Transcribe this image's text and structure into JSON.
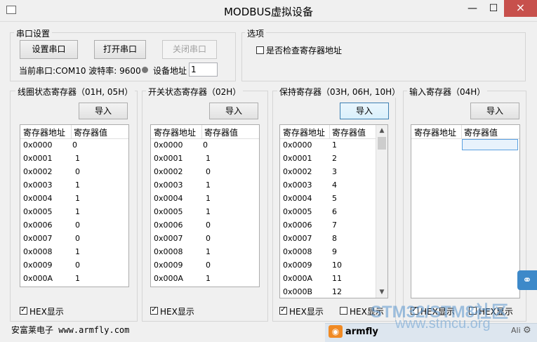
{
  "window": {
    "title": "MODBUS虚拟设备",
    "close_glyph": "×",
    "min_glyph": "—",
    "max_glyph": "☐"
  },
  "serial": {
    "group_label": "串口设置",
    "btn_setup": "设置串口",
    "btn_open": "打开串口",
    "btn_close": "关闭串口",
    "status": "当前串口:COM10 波特率: 9600",
    "device_addr_label": "设备地址",
    "device_addr_value": "1"
  },
  "options": {
    "group_label": "选项",
    "check_addr_label": "是否检查寄存器地址"
  },
  "panels": [
    {
      "title": "线圈状态寄存器（01H, 05H）",
      "import": "导入",
      "col_addr": "寄存器地址",
      "col_val": "寄存器值",
      "rows": [
        [
          "0x0000",
          "0"
        ],
        [
          "0x0001",
          "1"
        ],
        [
          "0x0002",
          "0"
        ],
        [
          "0x0003",
          "1"
        ],
        [
          "0x0004",
          "1"
        ],
        [
          "0x0005",
          "1"
        ],
        [
          "0x0006",
          "0"
        ],
        [
          "0x0007",
          "0"
        ],
        [
          "0x0008",
          "1"
        ],
        [
          "0x0009",
          "0"
        ],
        [
          "0x000A",
          "1"
        ]
      ],
      "hex_label": "HEX显示"
    },
    {
      "title": "开关状态寄存器（02H）",
      "import": "导入",
      "col_addr": "寄存器地址",
      "col_val": "寄存器值",
      "rows": [
        [
          "0x0000",
          "0"
        ],
        [
          "0x0001",
          "1"
        ],
        [
          "0x0002",
          "0"
        ],
        [
          "0x0003",
          "1"
        ],
        [
          "0x0004",
          "1"
        ],
        [
          "0x0005",
          "1"
        ],
        [
          "0x0006",
          "0"
        ],
        [
          "0x0007",
          "0"
        ],
        [
          "0x0008",
          "1"
        ],
        [
          "0x0009",
          "0"
        ],
        [
          "0x000A",
          "1"
        ]
      ],
      "hex_label": "HEX显示"
    },
    {
      "title": "保持寄存器（03H, 06H, 10H）",
      "import": "导入",
      "col_addr": "寄存器地址",
      "col_val": "寄存器值",
      "rows": [
        [
          "0x0000",
          "1"
        ],
        [
          "0x0001",
          "2"
        ],
        [
          "0x0002",
          "3"
        ],
        [
          "0x0003",
          "4"
        ],
        [
          "0x0004",
          "5"
        ],
        [
          "0x0005",
          "6"
        ],
        [
          "0x0006",
          "7"
        ],
        [
          "0x0007",
          "8"
        ],
        [
          "0x0008",
          "9"
        ],
        [
          "0x0009",
          "10"
        ],
        [
          "0x000A",
          "11"
        ],
        [
          "0x000B",
          "12"
        ]
      ],
      "hex_label": "HEX显示",
      "hex_label2": "HEX显示"
    },
    {
      "title": "输入寄存器（04H）",
      "import": "导入",
      "col_addr": "寄存器地址",
      "col_val": "寄存器值",
      "rows": [],
      "hex_label": "HEX显示",
      "hex_label2": "HEX显示"
    }
  ],
  "footer": {
    "company": "安富莱电子 www.armfly.com",
    "tray_name": "armfly",
    "tray_text": "Ali"
  },
  "watermark": {
    "line1": "STM32/STM8社区",
    "line2": "www.stmcu.org"
  },
  "colors": {
    "close_red": "#c7504c",
    "focus_blue": "#3c7fb1",
    "side_blue": "#3d89c9"
  }
}
